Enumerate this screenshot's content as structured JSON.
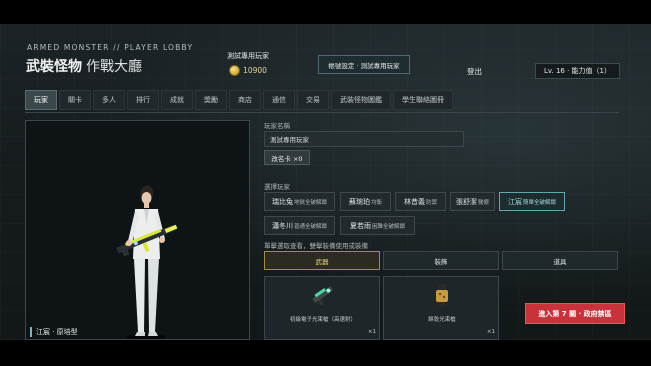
{
  "header": {
    "kicker": "ARMED MONSTER // PLAYER LOBBY",
    "title": "武裝怪物",
    "subtitle": "作戰大廳"
  },
  "player": {
    "name": "測試專用玩家",
    "coins": "10900",
    "coin_icon": "coin-icon"
  },
  "top_actions": {
    "account_button": "帳號設定 · 測試專用玩家",
    "logout": "登出",
    "level": "Lv. 16 · 能力值（1）"
  },
  "tabs": [
    {
      "label": "玩家",
      "active": true
    },
    {
      "label": "關卡",
      "active": false
    },
    {
      "label": "多人",
      "active": false
    },
    {
      "label": "排行",
      "active": false
    },
    {
      "label": "成就",
      "active": false
    },
    {
      "label": "獎勵",
      "active": false
    },
    {
      "label": "商店",
      "active": false
    },
    {
      "label": "通信",
      "active": false
    },
    {
      "label": "交易",
      "active": false
    },
    {
      "label": "武裝怪物圖鑑",
      "active": false
    },
    {
      "label": "學生聯絡圖冊",
      "active": false
    }
  ],
  "character_panel": {
    "caption": "江宸 · 原培型"
  },
  "player_name_section": {
    "label": "玩家名稱",
    "input_value": "測試專用玩家",
    "rename_button": "改名卡 ×0"
  },
  "select_player": {
    "label": "選擇玩家",
    "characters": [
      {
        "name": "瑞比兔",
        "tag": "地獄全破解鎖",
        "selected": false
      },
      {
        "name": "蘇琬珀",
        "tag": "均衡",
        "selected": false
      },
      {
        "name": "林昔義",
        "tag": "防禦",
        "selected": false
      },
      {
        "name": "張舒潔",
        "tag": "醫療",
        "selected": false
      },
      {
        "name": "江宸",
        "tag": "簡單全破解鎖",
        "selected": true
      },
      {
        "name": "瀟冬川",
        "tag": "普通全破解鎖",
        "selected": false
      },
      {
        "name": "夏若雨",
        "tag": "困難全破解鎖",
        "selected": false
      }
    ]
  },
  "equipment": {
    "label": "單擊選取查看，雙擊裝備使用或裝備",
    "tabs": [
      {
        "label": "武器",
        "active": true
      },
      {
        "label": "裝飾",
        "active": false
      },
      {
        "label": "道具",
        "active": false
      }
    ],
    "items": [
      {
        "name": "初級電子光束槍（高速射）",
        "count": "×1",
        "icon": "plasma-rifle-icon"
      },
      {
        "name": "餅乾光束槍",
        "count": "×1",
        "icon": "cookie-blaster-icon"
      }
    ]
  },
  "enter_button": "進入第 7 關 · 政府禁區"
}
